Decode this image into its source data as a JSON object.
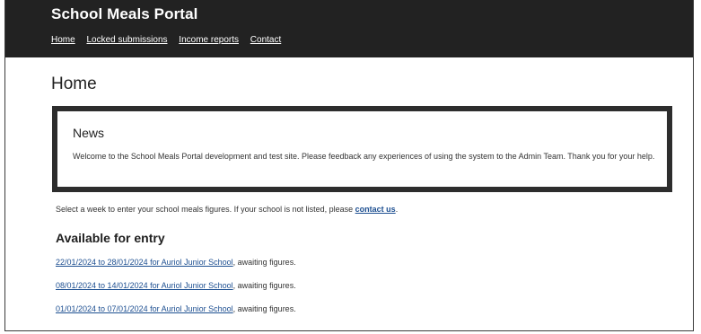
{
  "header": {
    "site_title": "School Meals Portal",
    "nav": [
      "Home",
      "Locked submissions",
      "Income reports",
      "Contact"
    ]
  },
  "page": {
    "title": "Home"
  },
  "news": {
    "title": "News",
    "body": "Welcome to the School Meals Portal development and test site. Please feedback any experiences of using the system to the Admin Team. Thank you for your help."
  },
  "intro": {
    "text_before": "Select a week to enter your school meals figures. If your school is not listed, please ",
    "link": "contact us",
    "text_after": "."
  },
  "available": {
    "title": "Available for entry",
    "entries": [
      {
        "link": "22/01/2024 to 28/01/2024 for Auriol Junior School",
        "status": ", awaiting figures."
      },
      {
        "link": "08/01/2024 to 14/01/2024 for Auriol Junior School",
        "status": ", awaiting figures."
      },
      {
        "link": "01/01/2024 to 07/01/2024 for Auriol Junior School",
        "status": ", awaiting figures."
      }
    ]
  },
  "colors": {
    "header_bg": "#222222",
    "link": "#1d4f91",
    "news_border": "#2d2d2d"
  }
}
